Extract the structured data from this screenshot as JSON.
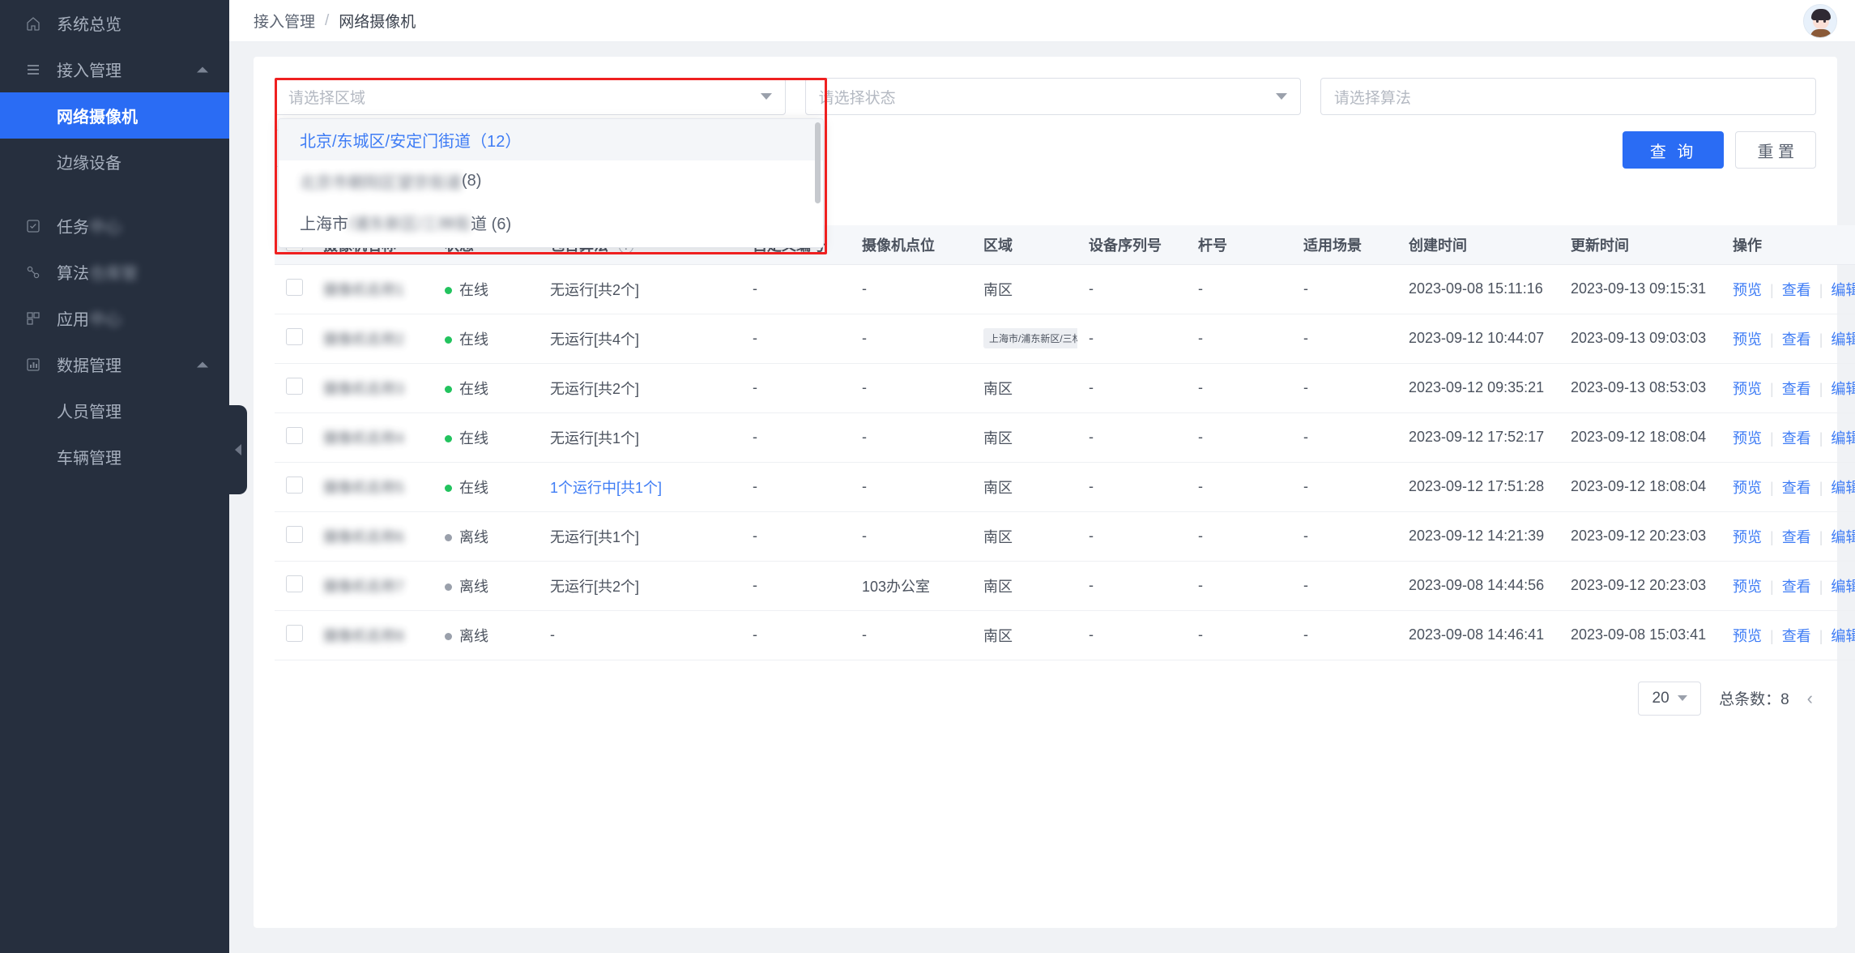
{
  "sidebar": {
    "items": [
      {
        "label": "系统总览",
        "icon": "home-icon",
        "type": "item",
        "blurred": false,
        "collapsible": false
      },
      {
        "label": "接入管理",
        "icon": "list-icon",
        "type": "item",
        "blurred": false,
        "collapsible": true
      },
      {
        "label": "网络摄像机",
        "type": "sub",
        "active": true
      },
      {
        "label": "边缘设备",
        "type": "sub",
        "active": false
      },
      {
        "label": "任务",
        "icon": "task-icon",
        "type": "item",
        "blurred": true,
        "collapsible": false
      },
      {
        "label": "算法",
        "icon": "algo-icon",
        "type": "item",
        "blurred": true,
        "collapsible": false
      },
      {
        "label": "应用",
        "icon": "app-icon",
        "type": "item",
        "blurred": true,
        "collapsible": false
      },
      {
        "label": "数据管理",
        "icon": "data-icon",
        "type": "item",
        "blurred": false,
        "collapsible": true
      },
      {
        "label": "人员管理",
        "type": "sub",
        "active": false
      },
      {
        "label": "车辆管理",
        "type": "sub",
        "active": false
      }
    ]
  },
  "topbar": {
    "breadcrumb_parent": "接入管理",
    "breadcrumb_sep": "/",
    "breadcrumb_current": "网络摄像机"
  },
  "filters": {
    "area_placeholder": "请选择区域",
    "state_placeholder": "请选择状态",
    "algo_placeholder": "请选择算法",
    "search_button": "查 询",
    "reset_button": "重 置"
  },
  "area_dropdown": {
    "options": [
      {
        "label": "北京/东城区/安定门街道（12）",
        "selected": true,
        "blurred": false
      },
      {
        "label": "(8)",
        "selected": false,
        "blurred": true,
        "prefix": "",
        "suffix": "(8)"
      },
      {
        "label": "上海市",
        "selected": false,
        "blurred": true,
        "prefix": "上海市",
        "suffix": "道 (6)"
      }
    ]
  },
  "table": {
    "headers": [
      "摄像机名称",
      "状态",
      "包含算法",
      "自定义编号",
      "摄像机点位",
      "区域",
      "设备序列号",
      "杆号",
      "适用场景",
      "创建时间",
      "更新时间",
      "操作"
    ],
    "algo_help_icon": "question-mark-icon",
    "rows": [
      {
        "name": "",
        "state": "在线",
        "online": true,
        "algo": "无运行[共2个]",
        "algo_link": false,
        "custom_no": "-",
        "spot": "-",
        "area": "南区",
        "area_badge": false,
        "sn": "-",
        "pole": "-",
        "scene": "-",
        "created": "2023-09-08 15:11:16",
        "updated": "2023-09-13 09:15:31"
      },
      {
        "name": "",
        "state": "在线",
        "online": true,
        "algo": "无运行[共4个]",
        "algo_link": false,
        "custom_no": "-",
        "spot": "-",
        "area": "上海市/浦东新区/三林镇",
        "area_badge": true,
        "sn": "-",
        "pole": "-",
        "scene": "-",
        "created": "2023-09-12 10:44:07",
        "updated": "2023-09-13 09:03:03"
      },
      {
        "name": "",
        "state": "在线",
        "online": true,
        "algo": "无运行[共2个]",
        "algo_link": false,
        "custom_no": "-",
        "spot": "-",
        "area": "南区",
        "area_badge": false,
        "sn": "-",
        "pole": "-",
        "scene": "-",
        "created": "2023-09-12 09:35:21",
        "updated": "2023-09-13 08:53:03"
      },
      {
        "name": "",
        "state": "在线",
        "online": true,
        "algo": "无运行[共1个]",
        "algo_link": false,
        "custom_no": "-",
        "spot": "-",
        "area": "南区",
        "area_badge": false,
        "sn": "-",
        "pole": "-",
        "scene": "-",
        "created": "2023-09-12 17:52:17",
        "updated": "2023-09-12 18:08:04"
      },
      {
        "name": "",
        "state": "在线",
        "online": true,
        "algo": "1个运行中[共1个]",
        "algo_link": true,
        "custom_no": "-",
        "spot": "-",
        "area": "南区",
        "area_badge": false,
        "sn": "-",
        "pole": "-",
        "scene": "-",
        "created": "2023-09-12 17:51:28",
        "updated": "2023-09-12 18:08:04"
      },
      {
        "name": "",
        "state": "离线",
        "online": false,
        "algo": "无运行[共1个]",
        "algo_link": false,
        "custom_no": "-",
        "spot": "-",
        "area": "南区",
        "area_badge": false,
        "sn": "-",
        "pole": "-",
        "scene": "-",
        "created": "2023-09-12 14:21:39",
        "updated": "2023-09-12 20:23:03"
      },
      {
        "name": "",
        "state": "离线",
        "online": false,
        "algo": "无运行[共2个]",
        "algo_link": false,
        "custom_no": "-",
        "spot": "103办公室",
        "area": "南区",
        "area_badge": false,
        "sn": "-",
        "pole": "-",
        "scene": "-",
        "created": "2023-09-08 14:44:56",
        "updated": "2023-09-12 20:23:03"
      },
      {
        "name": "",
        "state": "离线",
        "online": false,
        "algo": "-",
        "algo_link": false,
        "custom_no": "-",
        "spot": "-",
        "area": "南区",
        "area_badge": false,
        "sn": "-",
        "pole": "-",
        "scene": "-",
        "created": "2023-09-08 14:46:41",
        "updated": "2023-09-08 15:03:41"
      }
    ],
    "ops": {
      "preview": "预览",
      "view": "查看",
      "edit": "编辑"
    }
  },
  "pager": {
    "page_size": "20",
    "total_label": "总条数：8",
    "prev_arrow": "‹"
  },
  "colors": {
    "accent": "#2a6cf4",
    "sidebar_bg": "#262f3e",
    "online": "#22c35e",
    "offline": "#9aa0ab",
    "highlight_box": "#ef2020"
  }
}
